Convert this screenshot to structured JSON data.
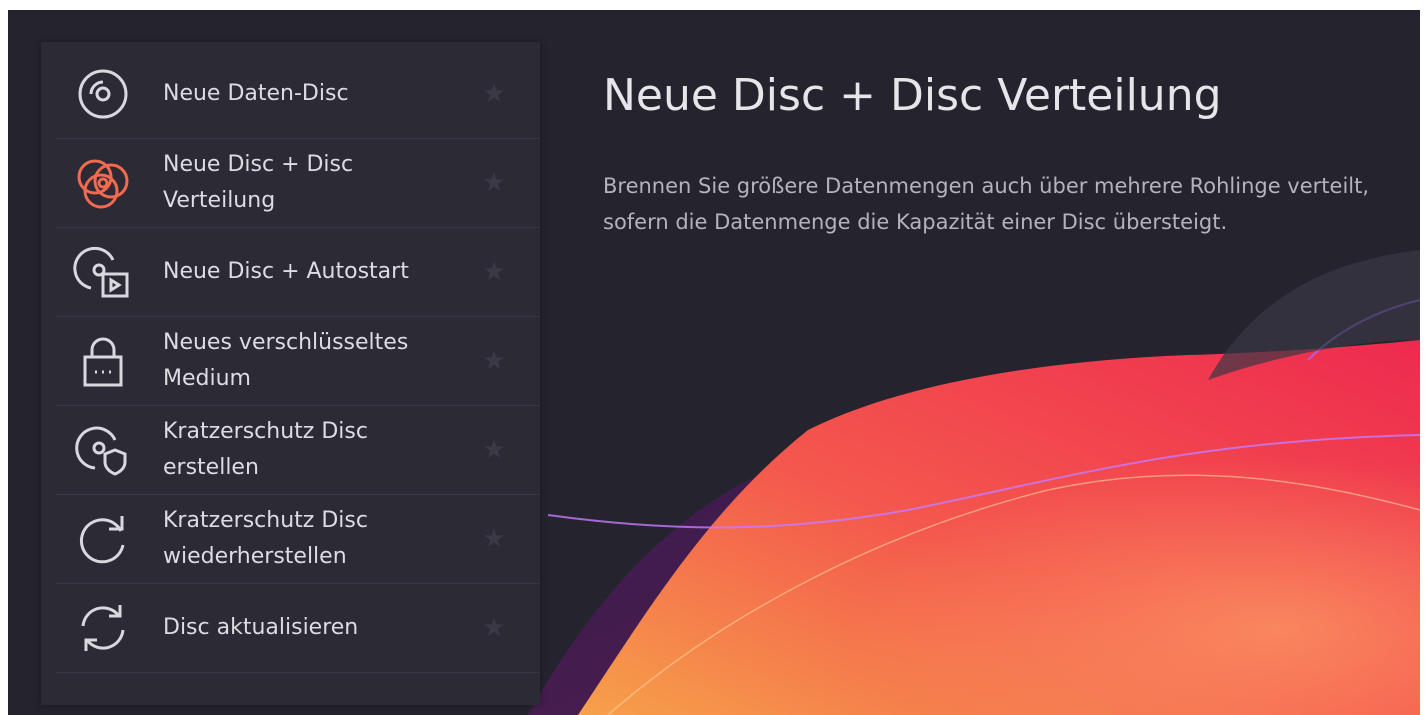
{
  "accent": "#f26a4f",
  "sidebar": {
    "items": [
      {
        "label": "Neue Daten-Disc",
        "icon": "disc-icon",
        "selected": false
      },
      {
        "label": "Neue Disc + Disc Verteilung",
        "icon": "disc-spanning-icon",
        "selected": true
      },
      {
        "label": "Neue Disc + Autostart",
        "icon": "disc-autostart-icon",
        "selected": false
      },
      {
        "label": "Neues verschlüsseltes Medium",
        "icon": "lock-icon",
        "selected": false
      },
      {
        "label": "Kratzerschutz Disc erstellen",
        "icon": "disc-shield-icon",
        "selected": false
      },
      {
        "label": "Kratzerschutz Disc wiederherstellen",
        "icon": "restore-icon",
        "selected": false
      },
      {
        "label": "Disc aktualisieren",
        "icon": "refresh-icon",
        "selected": false
      }
    ],
    "favorite_icon": "star-icon"
  },
  "main": {
    "title": "Neue Disc + Disc Verteilung",
    "description": "Brennen Sie größere Datenmengen auch über mehrere Rohlinge verteilt, sofern die Datenmenge die Kapazität einer Disc übersteigt."
  }
}
